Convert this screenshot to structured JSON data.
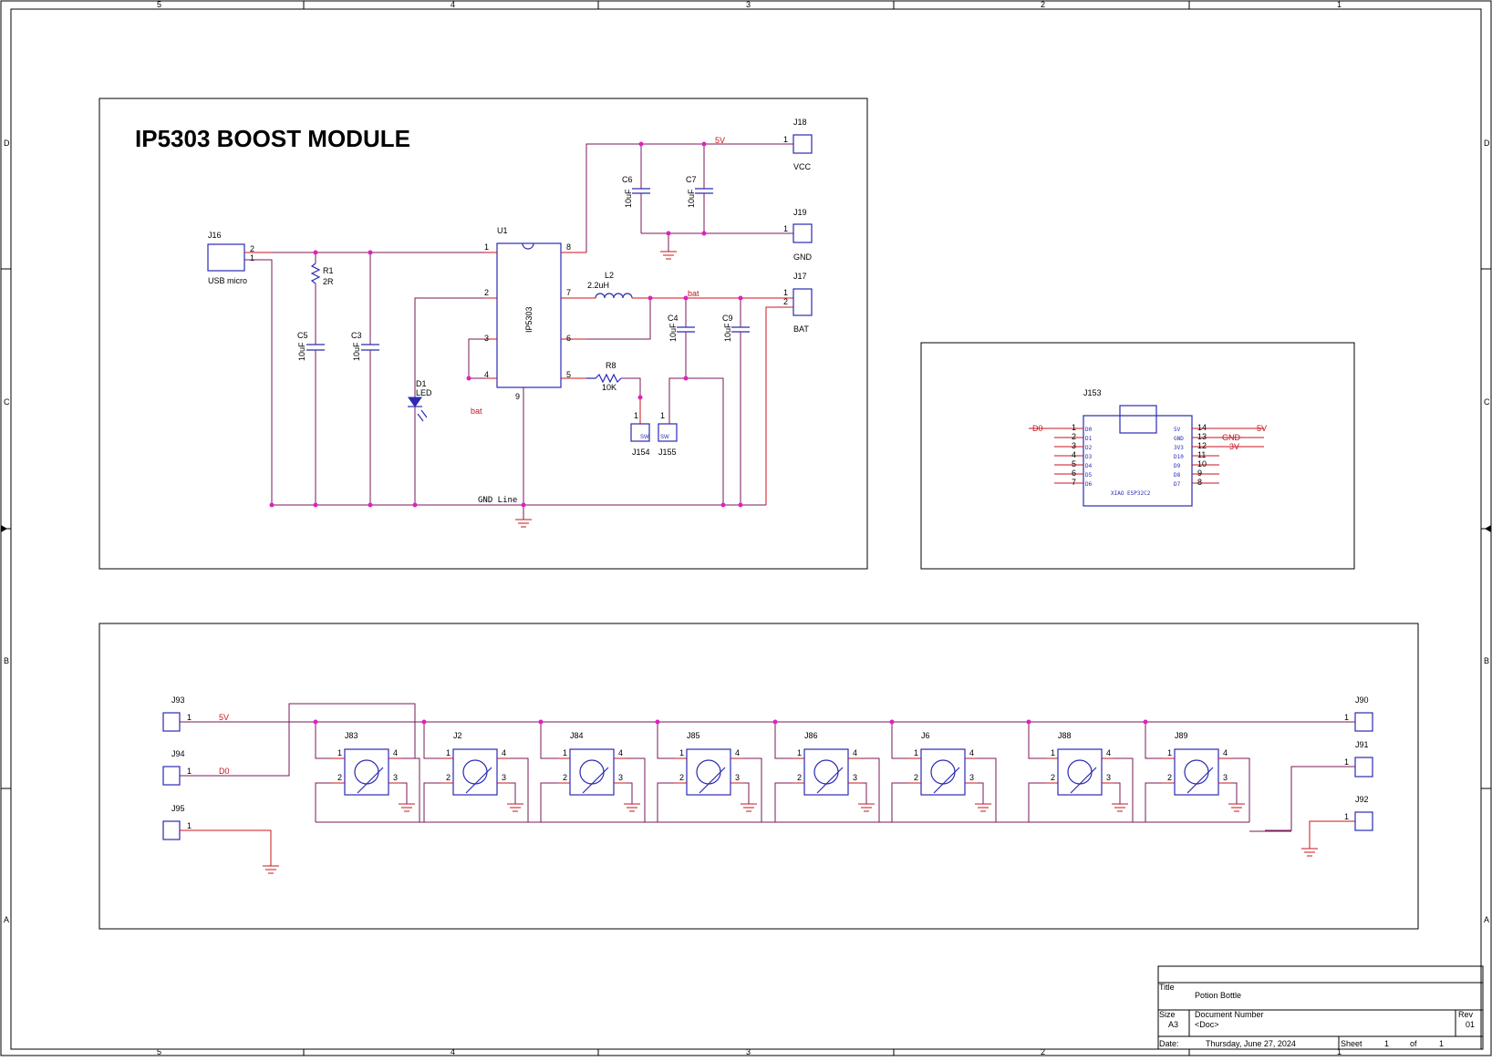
{
  "border": {
    "cols": [
      "5",
      "4",
      "3",
      "2",
      "1"
    ],
    "rows": [
      "D",
      "C",
      "B",
      "A"
    ]
  },
  "boost": {
    "title": "IP5303 BOOST MODULE",
    "j16": {
      "ref": "J16",
      "name": "USB micro",
      "pin1": "1",
      "pin2": "2"
    },
    "r1": {
      "ref": "R1",
      "value": "2R"
    },
    "c5": {
      "ref": "C5",
      "value": "10uF"
    },
    "c3": {
      "ref": "C3",
      "value": "10uF"
    },
    "d1": {
      "ref": "D1",
      "value": "LED"
    },
    "u1": {
      "ref": "U1",
      "name": "IP5303",
      "pins": [
        "1",
        "2",
        "3",
        "4",
        "5",
        "6",
        "7",
        "8",
        "9"
      ]
    },
    "l2": {
      "ref": "L2",
      "value": "2.2uH"
    },
    "r8": {
      "ref": "R8",
      "value": "10K"
    },
    "c4": {
      "ref": "C4",
      "value": "10uF"
    },
    "c9": {
      "ref": "C9",
      "value": "10uF"
    },
    "c6": {
      "ref": "C6",
      "value": "10uF"
    },
    "c7": {
      "ref": "C7",
      "value": "10uF"
    },
    "j18": {
      "ref": "J18",
      "name": "VCC",
      "pin": "1"
    },
    "j19": {
      "ref": "J19",
      "name": "GND",
      "pin": "1"
    },
    "j17": {
      "ref": "J17",
      "name": "BAT",
      "pin1": "1",
      "pin2": "2"
    },
    "j154": {
      "ref": "J154",
      "pin": "1",
      "body": "SW"
    },
    "j155": {
      "ref": "J155",
      "pin": "1",
      "body": "SW"
    },
    "net_5v": "5V",
    "net_bat": "bat",
    "net_gnd_line": "GND Line"
  },
  "mcu": {
    "ref": "J153",
    "name": "XIAO ESP32C2",
    "net_d0": "D0",
    "net_5v": "5V",
    "net_gnd": "GND",
    "net_3v": "3V",
    "left_pins": [
      "1",
      "2",
      "3",
      "4",
      "5",
      "6",
      "7"
    ],
    "left_names": [
      "D0",
      "D1",
      "D2",
      "D3",
      "D4",
      "D5",
      "D6"
    ],
    "right_pins": [
      "14",
      "13",
      "12",
      "11",
      "10",
      "9",
      "8"
    ],
    "right_names": [
      "5V",
      "GND",
      "3V3",
      "D10",
      "D9",
      "D8",
      "D7"
    ]
  },
  "leds": {
    "j93": {
      "ref": "J93",
      "pin": "1",
      "net": "5V"
    },
    "j94": {
      "ref": "J94",
      "pin": "1",
      "net": "D0"
    },
    "j95": {
      "ref": "J95",
      "pin": "1"
    },
    "j90": {
      "ref": "J90",
      "pin": "1"
    },
    "j91": {
      "ref": "J91",
      "pin": "1"
    },
    "j92": {
      "ref": "J92",
      "pin": "1"
    },
    "chain": [
      {
        "ref": "J83"
      },
      {
        "ref": "J2"
      },
      {
        "ref": "J84"
      },
      {
        "ref": "J85"
      },
      {
        "ref": "J86"
      },
      {
        "ref": "J6"
      },
      {
        "ref": "J88"
      },
      {
        "ref": "J89"
      }
    ],
    "pin_labels": [
      "1",
      "2",
      "3",
      "4"
    ]
  },
  "titleblock": {
    "title_label": "Title",
    "title": "Potion Bottle",
    "size_label": "Size",
    "size": "A3",
    "docnum_label": "Document Number",
    "docnum": "<Doc>",
    "rev_label": "Rev",
    "rev": "01",
    "date_label": "Date:",
    "date": "Thursday, June 27, 2024",
    "sheet_label": "Sheet",
    "sheet": "1",
    "of_label": "of",
    "sheets": "1"
  }
}
